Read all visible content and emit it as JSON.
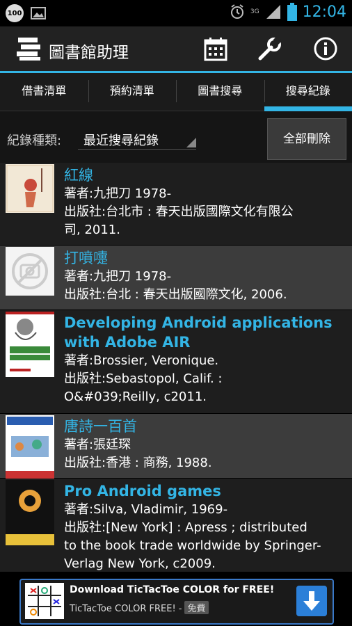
{
  "status": {
    "battery_badge": "100",
    "network": "3G",
    "time": "12:04"
  },
  "app": {
    "title": "圖書館助理"
  },
  "actions": [
    {
      "name": "calendar-icon"
    },
    {
      "name": "wrench-icon"
    },
    {
      "name": "info-icon"
    }
  ],
  "tabs": [
    {
      "label": "借書清單",
      "active": false
    },
    {
      "label": "預約清單",
      "active": false
    },
    {
      "label": "圖書搜尋",
      "active": false
    },
    {
      "label": "搜尋紀錄",
      "active": true
    }
  ],
  "filter": {
    "label": "紀錄種類:",
    "selected": "最近搜尋紀錄",
    "delete_label": "全部刪除"
  },
  "books": [
    {
      "title": "紅線",
      "author": "著者:九把刀 1978-",
      "publisher": "出版社:台北市 : 春天出版國際文化有限公",
      "publisher2": "司, 2011.",
      "cover": "painting"
    },
    {
      "title": "打噴嚏",
      "author": "著者:九把刀 1978-",
      "publisher": "出版社:台北 : 春天出版國際文化, 2006.",
      "publisher2": "",
      "cover": "placeholder"
    },
    {
      "title": "Developing Android applications",
      "title2": "with Adobe AIR",
      "author": "著者:Brossier, Veronique.",
      "publisher": "出版社:Sebastopol, Calif. :",
      "publisher2": "O&#039;Reilly, c2011.",
      "cover": "oreilly"
    },
    {
      "title": "唐詩一百首",
      "author": "著者:張廷琛",
      "publisher": "出版社:香港 : 商務, 1988.",
      "publisher2": "",
      "cover": "blue"
    },
    {
      "title": "Pro Android games",
      "author": "著者:Silva, Vladimir, 1969-",
      "publisher": "出版社:[New York] : Apress ; distributed",
      "publisher2": "to the book trade worldwide by Springer-",
      "publisher3": "Verlag New York, c2009.",
      "cover": "apress"
    }
  ],
  "ad": {
    "line1": "Download TicTacToe COLOR for FREE!",
    "line2": "TicTacToe COLOR FREE! -",
    "tag": "免費"
  },
  "colors": {
    "accent": "#33b5e5",
    "bg": "#000000",
    "row_dark": "#1e1e1e",
    "row_light": "#3c3c3c"
  }
}
